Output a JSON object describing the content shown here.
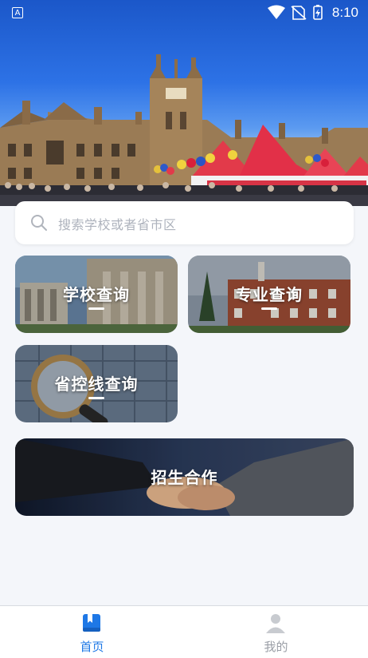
{
  "status_bar": {
    "time": "8:10",
    "app_icon_letter": "A"
  },
  "search": {
    "placeholder": "搜索学校或者省市区"
  },
  "cards": {
    "school": {
      "label": "学校查询"
    },
    "major": {
      "label": "专业查询"
    },
    "score_line": {
      "label": "省控线查询"
    },
    "cooperation": {
      "label": "招生合作"
    }
  },
  "bottom_nav": {
    "home": {
      "label": "首页"
    },
    "mine": {
      "label": "我的"
    }
  },
  "colors": {
    "accent": "#1e78e6",
    "inactive": "#9a9ea6",
    "background": "#f4f6fa"
  }
}
